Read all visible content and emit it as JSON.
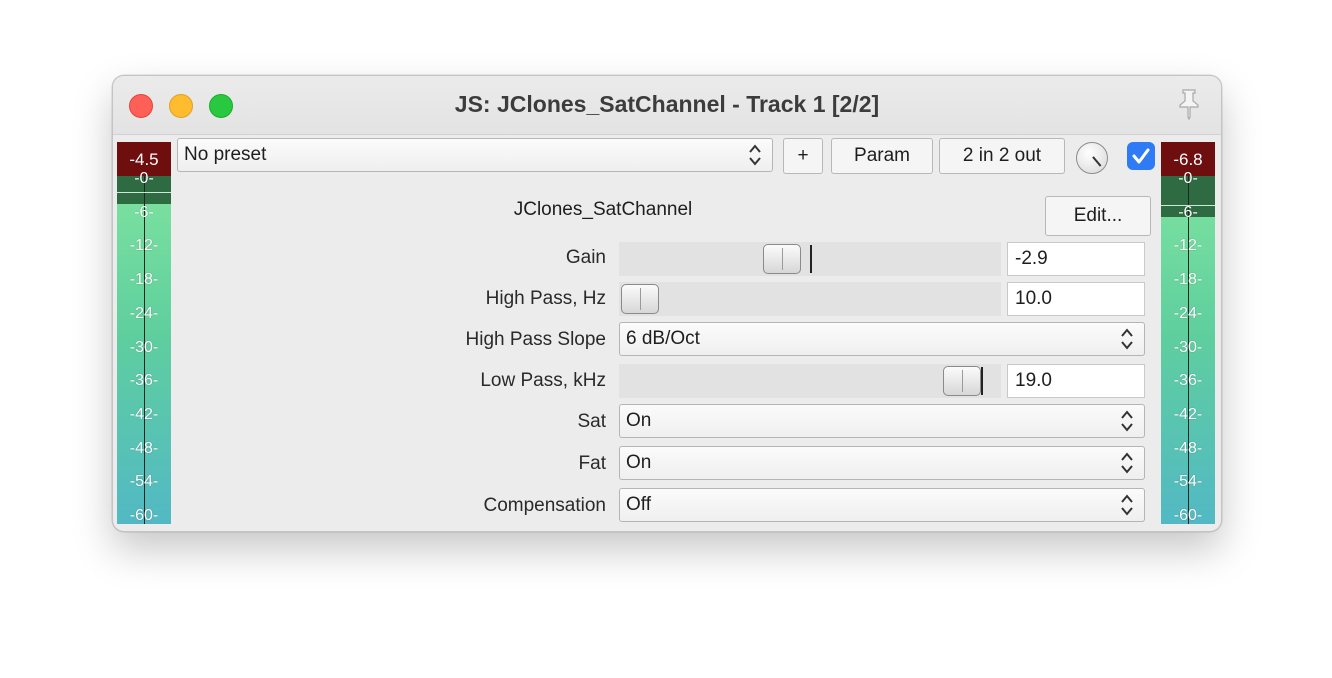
{
  "window": {
    "title": "JS: JClones_SatChannel - Track 1 [2/2]"
  },
  "toolbar": {
    "preset_value": "No preset",
    "add_label": "+",
    "param_label": "Param",
    "io_label": "2 in 2 out",
    "enabled": true
  },
  "meters": {
    "ticks": [
      "-0-",
      "-6-",
      "-12-",
      "-18-",
      "-24-",
      "-30-",
      "-36-",
      "-42-",
      "-48-",
      "-54-",
      "-60-"
    ],
    "input": {
      "peak_label": "-4.5",
      "level_db": -4.5
    },
    "output": {
      "peak_label": "-6.8",
      "level_db": -6.8
    },
    "colors": {
      "peak": "#6e0e0e",
      "unlit": "#2e6a42",
      "lit_top": "#9df0b0",
      "lit_bottom": "#52b9c4"
    }
  },
  "plugin": {
    "name": "JClones_SatChannel",
    "edit_label": "Edit...",
    "params": [
      {
        "label": "Gain",
        "type": "slider",
        "value": "-2.9"
      },
      {
        "label": "High Pass, Hz",
        "type": "slider",
        "value": "10.0"
      },
      {
        "label": "High Pass Slope",
        "type": "select",
        "value": "6 dB/Oct"
      },
      {
        "label": "Low Pass, kHz",
        "type": "slider",
        "value": "19.0"
      },
      {
        "label": "Sat",
        "type": "select",
        "value": "On"
      },
      {
        "label": "Fat",
        "type": "select",
        "value": "On"
      },
      {
        "label": "Compensation",
        "type": "select",
        "value": "Off"
      }
    ]
  },
  "colors": {
    "accent": "#2f7bf5",
    "window_bg": "#ececec"
  }
}
